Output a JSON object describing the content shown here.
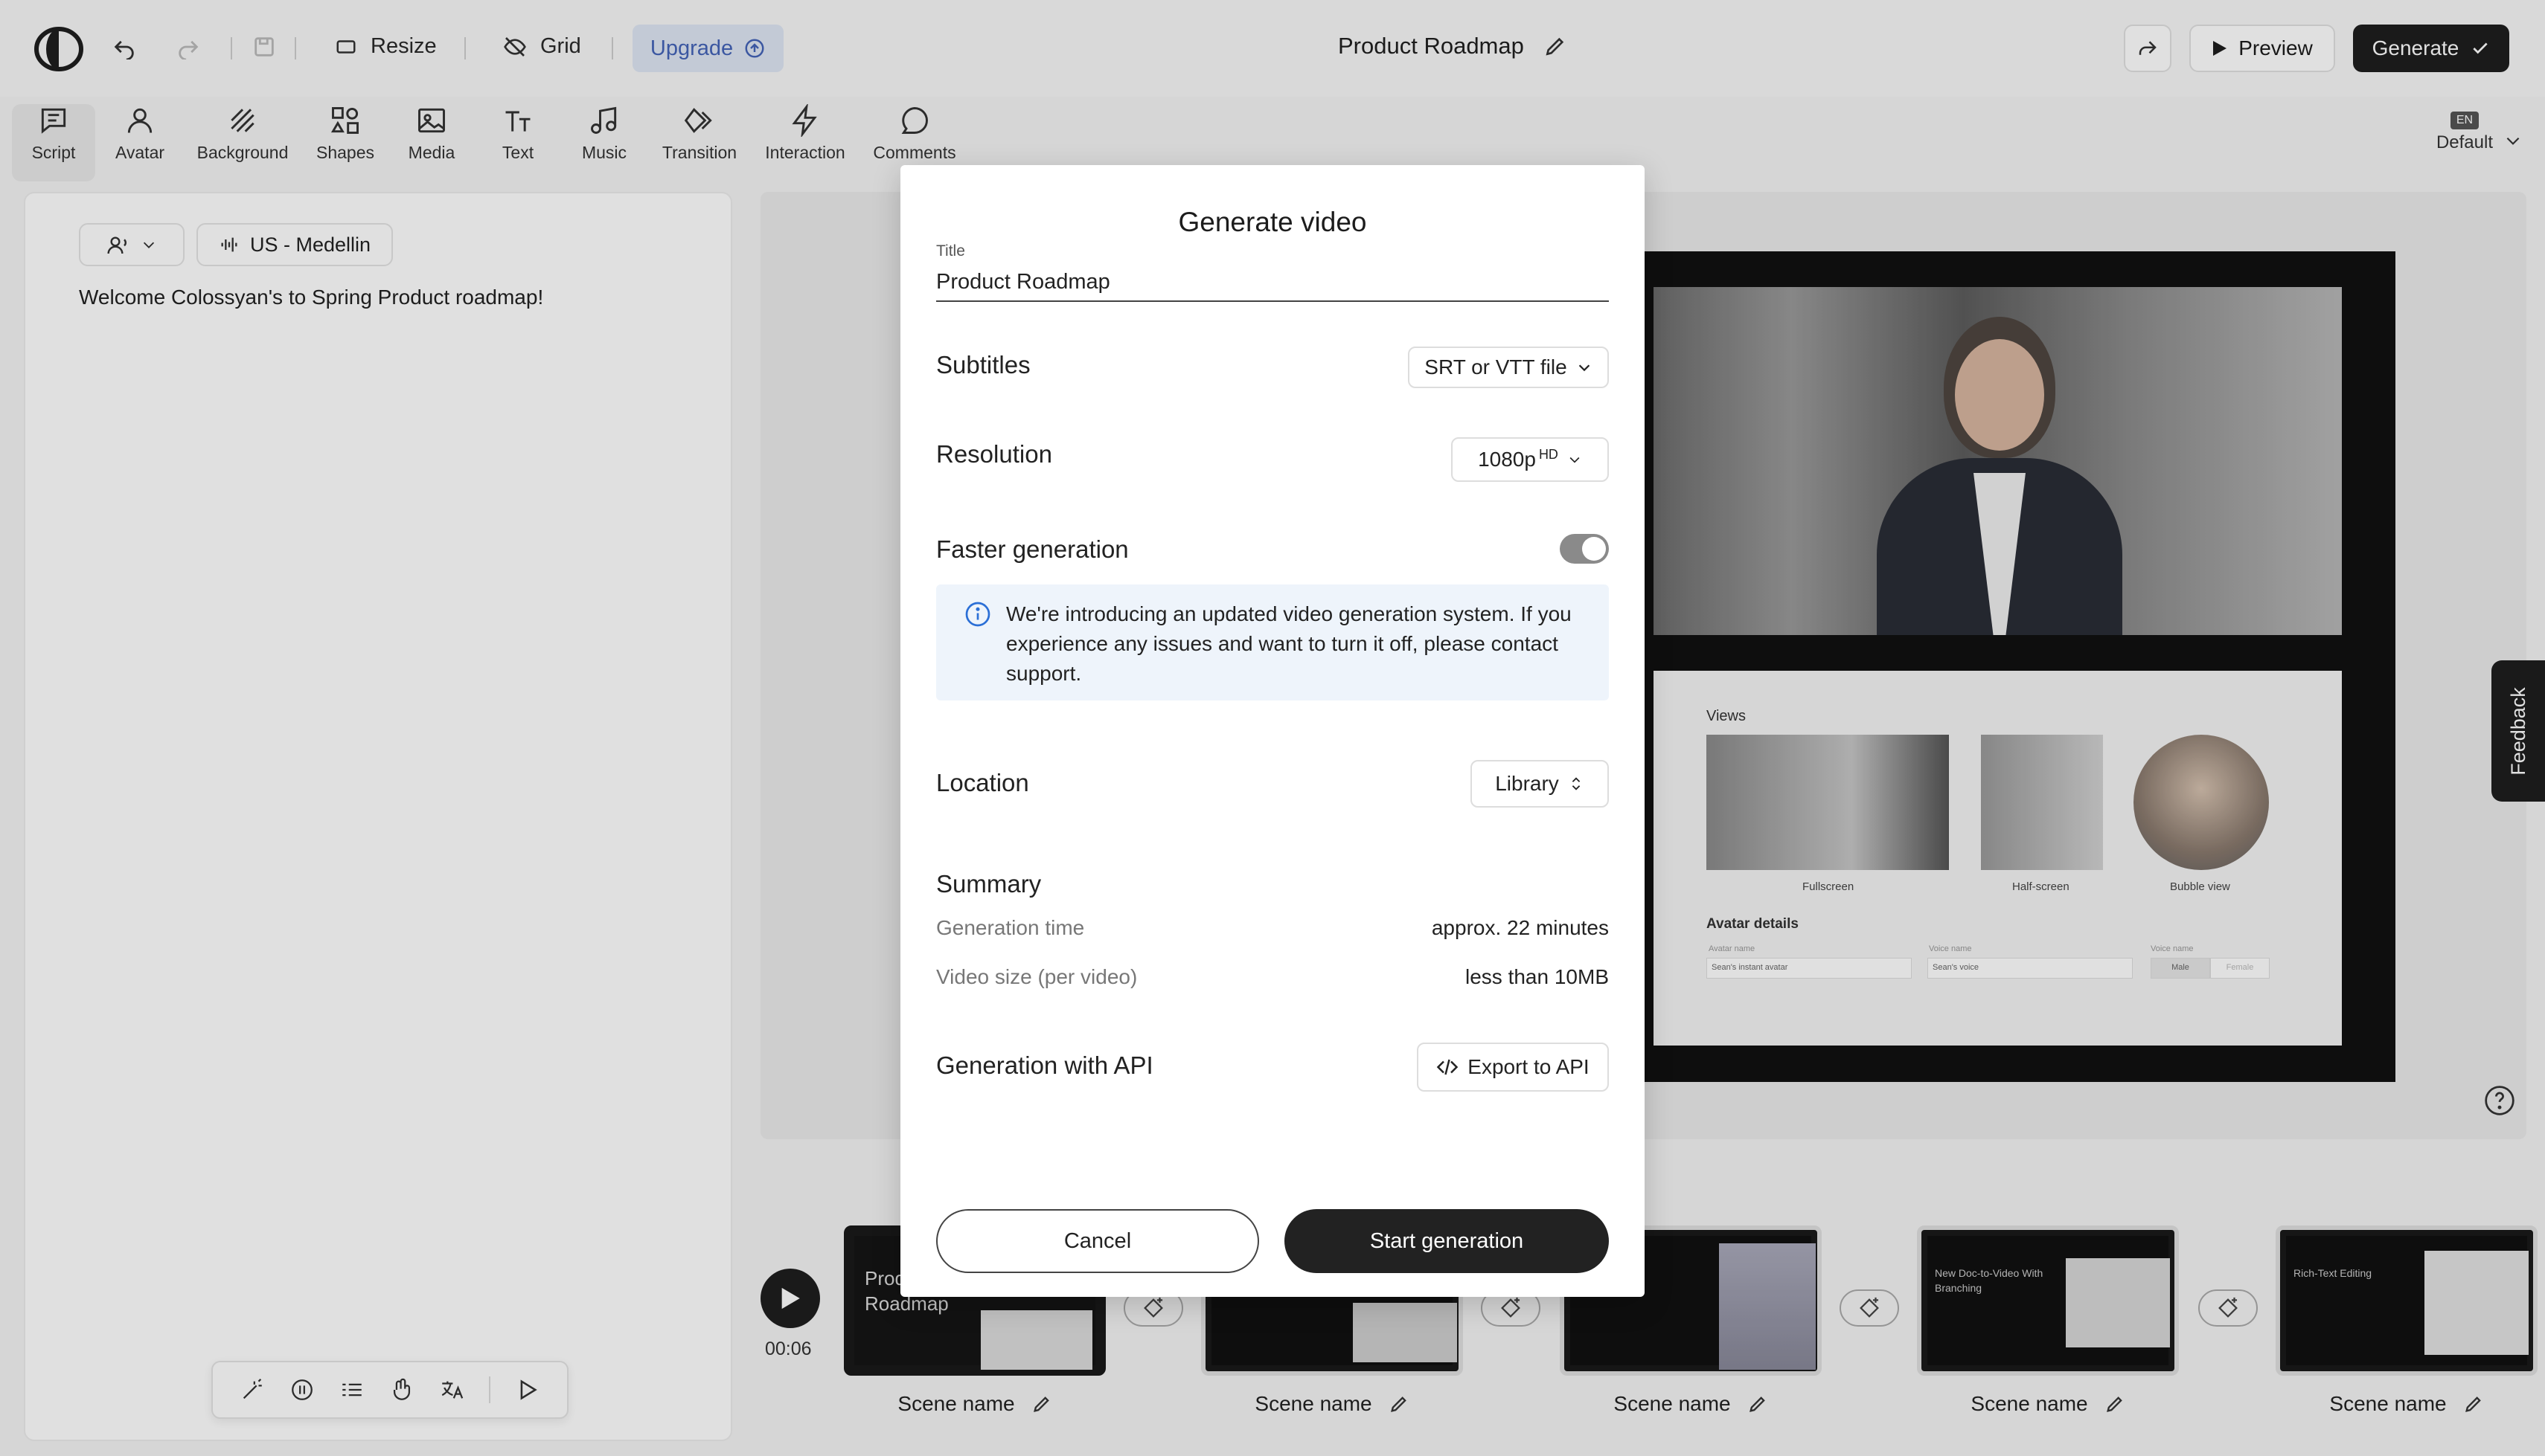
{
  "topbar": {
    "resize_label": "Resize",
    "grid_label": "Grid",
    "upgrade_label": "Upgrade",
    "doc_title": "Product Roadmap",
    "preview_label": "Preview",
    "generate_label": "Generate"
  },
  "tools": [
    {
      "label": "Script",
      "icon": "script-icon"
    },
    {
      "label": "Avatar",
      "icon": "avatar-icon"
    },
    {
      "label": "Background",
      "icon": "background-icon"
    },
    {
      "label": "Shapes",
      "icon": "shapes-icon"
    },
    {
      "label": "Media",
      "icon": "media-icon"
    },
    {
      "label": "Text",
      "icon": "text-icon"
    },
    {
      "label": "Music",
      "icon": "music-icon"
    },
    {
      "label": "Transition",
      "icon": "transition-icon"
    },
    {
      "label": "Interaction",
      "icon": "interaction-icon"
    },
    {
      "label": "Comments",
      "icon": "comments-icon"
    }
  ],
  "language": {
    "badge": "EN",
    "label": "Default"
  },
  "script": {
    "voice_label": "US - Medellin",
    "text": "Welcome Colossyan's to Spring Product roadmap!"
  },
  "canvas": {
    "views_title": "Views",
    "view_captions": [
      "Fullscreen",
      "Half-screen",
      "Bubble view"
    ],
    "avatar_details_title": "Avatar details",
    "field_labels": [
      "Avatar name",
      "Voice name",
      "Voice name"
    ],
    "field_values": [
      "Sean's instant avatar",
      "Sean's voice"
    ],
    "gender_options": [
      "Male",
      "Female"
    ]
  },
  "feedback_label": "Feedback",
  "timeline": {
    "time": "00:06",
    "scenes": [
      {
        "name": "Scene name",
        "thumb_title": "Product Roadmap"
      },
      {
        "name": "Scene name",
        "thumb_title": ""
      },
      {
        "name": "Scene name",
        "thumb_title": ""
      },
      {
        "name": "Scene name",
        "thumb_title": "New Doc-to-Video With Branching"
      },
      {
        "name": "Scene name",
        "thumb_title": "Rich-Text Editing"
      }
    ]
  },
  "modal": {
    "title": "Generate video",
    "title_field_label": "Title",
    "title_field_value": "Product Roadmap",
    "subtitles_label": "Subtitles",
    "subtitles_value": "SRT or VTT file",
    "resolution_label": "Resolution",
    "resolution_value": "1080p",
    "resolution_badge": "HD",
    "faster_label": "Faster generation",
    "faster_enabled": true,
    "info_text": "We're introducing an updated video generation system. If you experience any issues and want to turn it off, please contact support.",
    "location_label": "Location",
    "location_value": "Library",
    "summary_title": "Summary",
    "gen_time_label": "Generation time",
    "gen_time_value": "approx. 22 minutes",
    "video_size_label": "Video size (per video)",
    "video_size_value": "less than 10MB",
    "api_label": "Generation with API",
    "export_label": "Export to API",
    "cancel_label": "Cancel",
    "start_label": "Start generation"
  }
}
